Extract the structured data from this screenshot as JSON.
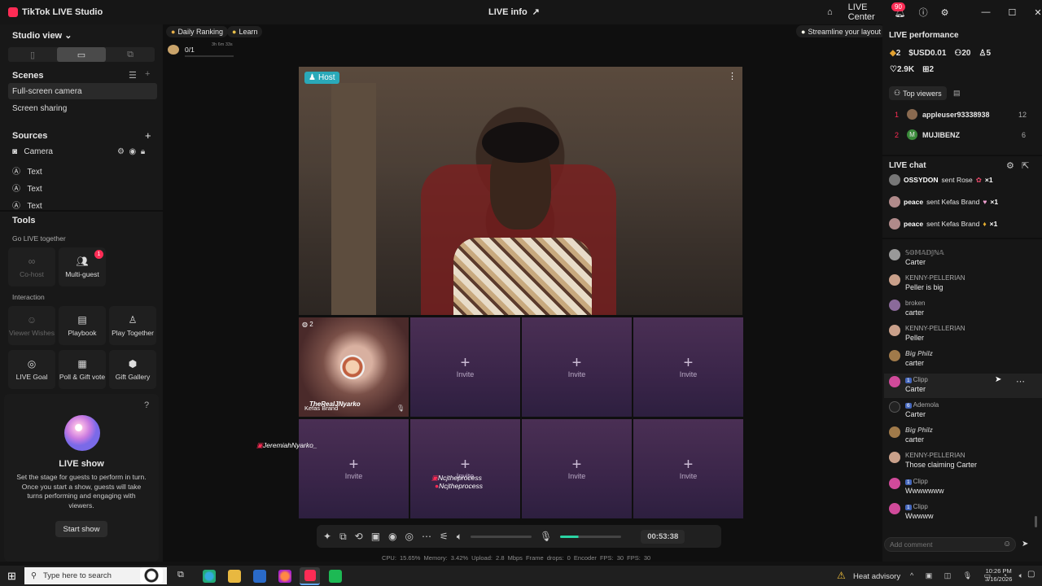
{
  "titlebar": {
    "app_name": "TikTok LIVE Studio",
    "live_info": "LIVE info",
    "live_center": "LIVE Center",
    "notif_count": "90"
  },
  "left": {
    "studio_view": "Studio view",
    "scenes_title": "Scenes",
    "scenes": [
      "Full-screen camera",
      "Screen sharing"
    ],
    "sources_title": "Sources",
    "sources": [
      "Camera",
      "Text",
      "Text",
      "Text"
    ],
    "tools_title": "Tools",
    "go_live_together": "Go LIVE together",
    "cohost": "Co-host",
    "multiguest": "Multi-guest",
    "multiguest_badge": "1",
    "interaction": "Interaction",
    "viewer_wishes": "Viewer Wishes",
    "playbook": "Playbook",
    "play_together": "Play Together",
    "live_goal": "LIVE Goal",
    "poll_gift": "Poll & Gift vote",
    "gift_gallery": "Gift Gallery",
    "show_title": "LIVE show",
    "show_desc": "Set the stage for guests to perform in turn. Once you start a show, guests will take turns performing and engaging with viewers.",
    "start_show": "Start show"
  },
  "center": {
    "daily_ranking": "Daily Ranking",
    "learn": "Learn",
    "goal_progress": "0/1",
    "goal_time": "3h 6m 33s",
    "streamline": "Streamline your layout",
    "host_label": "Host",
    "guest_count": "2",
    "guest1_name": "TheRealJNyarko",
    "guest1_sub": "Kefas Brand",
    "side_name": "JeremiahNyarko_",
    "slot_label": "Invite",
    "ncj_1": "Ncjtheprocess",
    "ncj_2": "Ncjtheprocess",
    "timer": "00:53:38",
    "stats": "CPU: 15.65%   Memory: 3.42%   Upload: 2.8 Mbps   Frame drops: 0   Encoder FPS: 30   FPS: 30"
  },
  "right": {
    "perf_title": "LIVE performance",
    "diamonds": "2",
    "usd": "USD0.01",
    "viewers": "20",
    "followers": "5",
    "likes": "2.9K",
    "gifts": "2",
    "top_viewers": "Top viewers",
    "viewer1": {
      "rank": "1",
      "name": "appleuser93338938",
      "score": "12"
    },
    "viewer2": {
      "rank": "2",
      "name": "MUJIBENZ",
      "score": "6"
    },
    "chat_title": "LIVE chat",
    "gifts_list": [
      {
        "name": "OSSYDON",
        "text": "sent Rose",
        "count": "×1"
      },
      {
        "name": "peace",
        "text": "sent Kefas Brand",
        "count": "×1"
      },
      {
        "name": "peace",
        "text": "sent Kefas Brand",
        "count": "×1"
      }
    ],
    "messages": [
      {
        "name": "𝕊𝕆𝕄𝔸𝔻𝕁ℕ𝔸",
        "msg": "Carter"
      },
      {
        "name": "KENNY-PELLERIAN",
        "msg": "Peller is big"
      },
      {
        "name": "broken",
        "msg": "carter"
      },
      {
        "name": "KENNY-PELLERIAN",
        "msg": "Peller"
      },
      {
        "name": "Big Philz",
        "msg": "carter"
      },
      {
        "name": "Clipp",
        "msg": "Carter"
      },
      {
        "name": "Ademola",
        "msg": "Carter"
      },
      {
        "name": "Big Philz",
        "msg": "carter"
      },
      {
        "name": "KENNY-PELLERIAN",
        "msg": "Those claiming Carter"
      },
      {
        "name": "Clipp",
        "msg": "Wwwwwww"
      },
      {
        "name": "Clipp",
        "msg": "Wwwww"
      }
    ],
    "lvl1": "1",
    "lvl6": "6",
    "comment_placeholder": "Add comment"
  },
  "taskbar": {
    "search_placeholder": "Type here to search",
    "weather": "Heat advisory",
    "time": "10:26 PM",
    "date": "3/16/2026"
  },
  "colors": {
    "accent": "#fe2c55",
    "host_badge": "#2aa9b9",
    "slot": "#3a2549"
  }
}
